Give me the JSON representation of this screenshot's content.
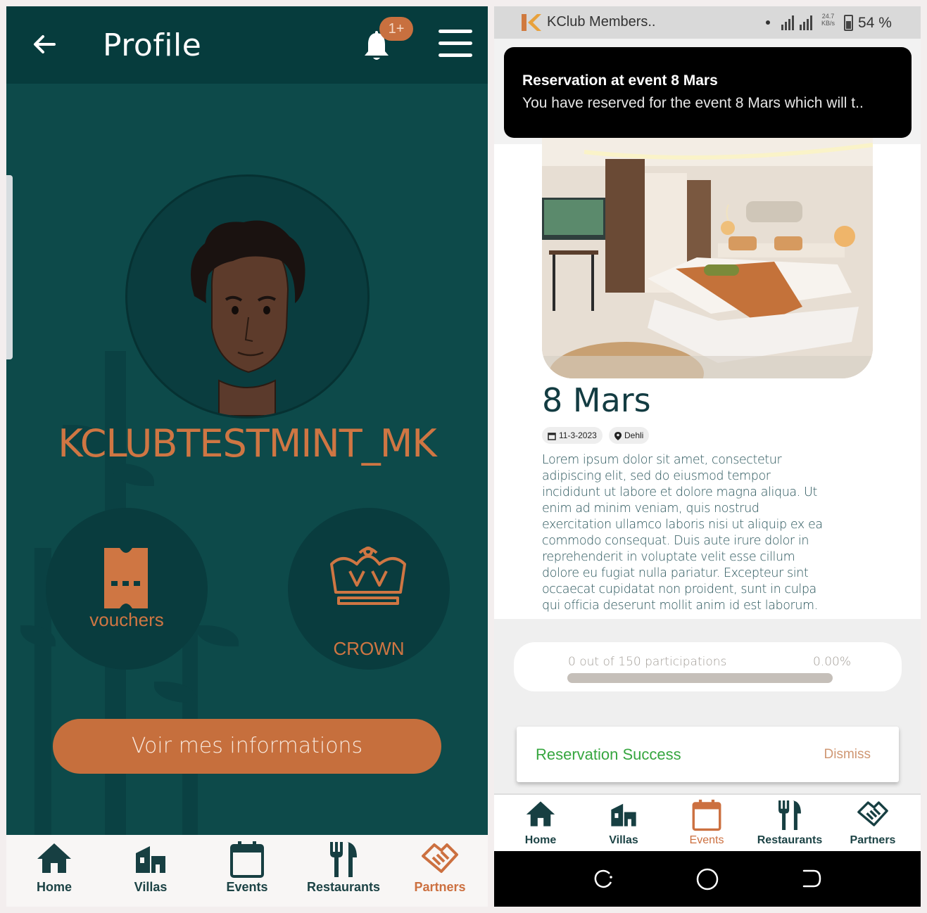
{
  "left": {
    "header": {
      "title": "Profile",
      "notification_badge": "1+"
    },
    "profile": {
      "username": "KCLUBTESTMINT_MK"
    },
    "shortcuts": {
      "vouchers_label": "vouchers",
      "crown_label": "CROWN"
    },
    "info_button": "Voir mes informations",
    "bottom_nav": [
      {
        "label": "Home",
        "icon": "home-icon",
        "active": false
      },
      {
        "label": "Villas",
        "icon": "villa-icon",
        "active": false
      },
      {
        "label": "Events",
        "icon": "calendar-icon",
        "active": false
      },
      {
        "label": "Restaurants",
        "icon": "restaurant-icon",
        "active": false
      },
      {
        "label": "Partners",
        "icon": "handshake-icon",
        "active": true
      }
    ]
  },
  "right": {
    "status_bar": {
      "app_name": "KClub Members..",
      "net_speed": "24.7",
      "net_unit": "KB/s",
      "battery": "54 %"
    },
    "notification": {
      "title": "Reservation at event 8 Mars",
      "body": "You have reserved for the event 8 Mars which will t.."
    },
    "event": {
      "title": "8 Mars",
      "date": "11-3-2023",
      "location": "Dehli",
      "description": "Lorem ipsum dolor sit amet, consectetur adipiscing elit, sed do eiusmod tempor incididunt ut labore et dolore magna aliqua. Ut enim ad minim veniam, quis nostrud exercitation ullamco laboris nisi ut aliquip ex ea commodo consequat. Duis aute irure dolor in reprehenderit in voluptate velit esse cillum dolore eu fugiat nulla pariatur. Excepteur sint occaecat cupidatat non proident, sunt in culpa qui officia deserunt mollit anim id est laborum."
    },
    "participation": {
      "text": "0 out of 150 participations",
      "percent_label": "0.00%",
      "fraction": 0
    },
    "snackbar": {
      "message": "Reservation Success",
      "action": "Dismiss"
    },
    "bottom_nav": [
      {
        "label": "Home",
        "icon": "home-icon",
        "active": false
      },
      {
        "label": "Villas",
        "icon": "villa-icon",
        "active": false
      },
      {
        "label": "Events",
        "icon": "calendar-icon",
        "active": true
      },
      {
        "label": "Restaurants",
        "icon": "restaurant-icon",
        "active": false
      },
      {
        "label": "Partners",
        "icon": "handshake-icon",
        "active": false
      }
    ]
  },
  "colors": {
    "teal": "#0d4a4a",
    "accent": "#cc7040",
    "success": "#36a63f"
  }
}
